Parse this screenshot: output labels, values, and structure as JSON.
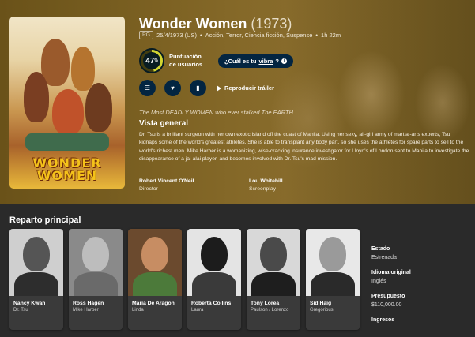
{
  "movie": {
    "title": "Wonder Women",
    "year": "(1973)",
    "certification": "PG",
    "release": "25/4/1973 (US)",
    "genres": "Acción, Terror, Ciencia ficción, Suspense",
    "runtime": "1h 22m",
    "score": "47",
    "score_pct": "%",
    "score_value": 0.47,
    "score_label": "Puntuación de usuarios",
    "vibe_prefix": "¿Cuál es tu",
    "vibe_link": "vibra",
    "vibe_suffix": "?",
    "trailer": "Reproducir tráiler",
    "tagline": "The Most DEADLY WOMEN who ever stalked The EARTH.",
    "overview_heading": "Vista general",
    "overview": "Dr. Tsu is a brilliant surgeon with her own exotic island off the coast of Manila. Using her sexy, all-girl army of martial-arts experts, Tsu kidnaps some of the world's greatest athletes. She is able to transplant any body part, so she uses the athletes for spare parts to sell to the world's richest men. Mike Harber is a womanizing, wise-cracking insurance investigator for Lloyd's of London sent to Manila to investigate the disappearance of a jai-alai player, and becomes involved with Dr. Tsu's mad mission.",
    "poster_title": "WONDER WOMEN",
    "crew": [
      {
        "name": "Robert Vincent O'Neil",
        "role": "Director"
      },
      {
        "name": "Lou Whitehill",
        "role": "Screenplay"
      }
    ]
  },
  "dots": "•",
  "cast_heading": "Reparto principal",
  "cast": [
    {
      "name": "Nancy Kwan",
      "role": "Dr. Tsu"
    },
    {
      "name": "Ross Hagen",
      "role": "Mike Harber"
    },
    {
      "name": "Maria De Aragon",
      "role": "Linda"
    },
    {
      "name": "Roberta Collins",
      "role": "Laura"
    },
    {
      "name": "Tony Lorea",
      "role": "Paulson / Lorenzo"
    },
    {
      "name": "Sid Haig",
      "role": "Gregorious"
    }
  ],
  "facts": [
    {
      "label": "Estado",
      "value": "Estrenada"
    },
    {
      "label": "Idioma original",
      "value": "Inglés"
    },
    {
      "label": "Presupuesto",
      "value": "$110,000.00"
    },
    {
      "label": "Ingresos",
      "value": ""
    }
  ],
  "colors": {
    "score_ring": "#d2d531",
    "score_track": "#423d0f",
    "button_bg": "#032541"
  },
  "icons": {
    "list": "list-icon",
    "favorite": "heart-icon",
    "watchlist": "bookmark-icon",
    "play": "play-icon",
    "info": "info-icon"
  }
}
